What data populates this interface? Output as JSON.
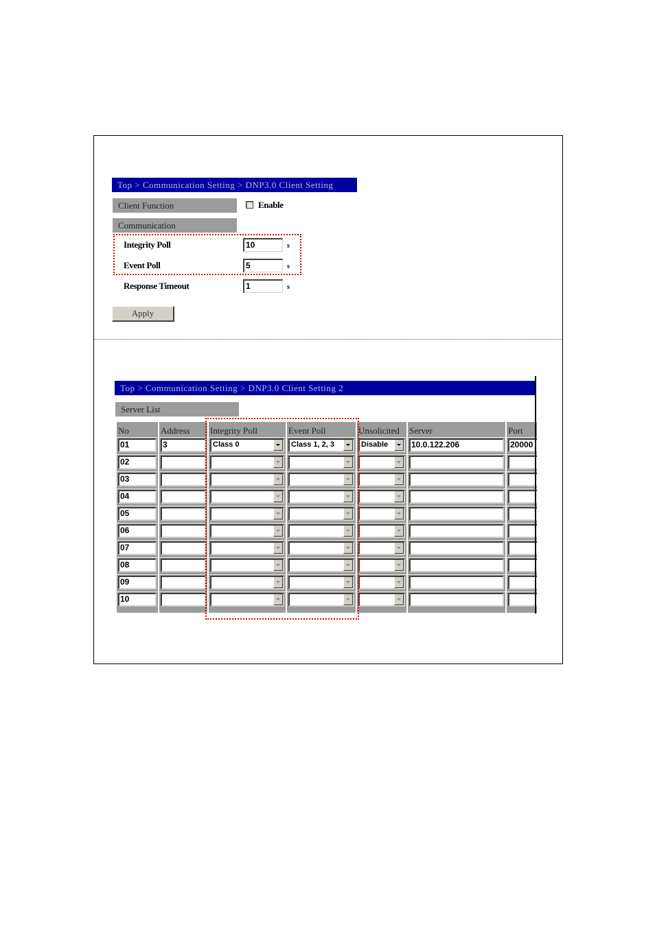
{
  "panel1": {
    "breadcrumb": "Top > Communication Setting > DNP3.0 Client Setting",
    "client_function_label": "Client Function",
    "enable_label": "Enable",
    "enable_checked": false,
    "communication_label": "Communication",
    "fields": [
      {
        "label": "Integrity Poll",
        "value": "10",
        "unit": "s"
      },
      {
        "label": "Event Poll",
        "value": "5",
        "unit": "s"
      },
      {
        "label": "Response Timeout",
        "value": "1",
        "unit": "s"
      }
    ],
    "apply_label": "Apply"
  },
  "panel2": {
    "breadcrumb": "Top > Communication Setting > DNP3.0 Client Setting 2",
    "server_list_label": "Server List",
    "columns": [
      "No",
      "Address",
      "Integrity Poll",
      "Event Poll",
      "Unsolicited",
      "Server",
      "Port"
    ],
    "rows": [
      {
        "no": "01",
        "address": "3",
        "integrity_poll": "Class 0",
        "event_poll": "Class 1, 2, 3",
        "unsolicited": "Disable",
        "server": "10.0.122.206",
        "port": "20000"
      },
      {
        "no": "02",
        "address": "",
        "integrity_poll": "",
        "event_poll": "",
        "unsolicited": "",
        "server": "",
        "port": ""
      },
      {
        "no": "03",
        "address": "",
        "integrity_poll": "",
        "event_poll": "",
        "unsolicited": "",
        "server": "",
        "port": ""
      },
      {
        "no": "04",
        "address": "",
        "integrity_poll": "",
        "event_poll": "",
        "unsolicited": "",
        "server": "",
        "port": ""
      },
      {
        "no": "05",
        "address": "",
        "integrity_poll": "",
        "event_poll": "",
        "unsolicited": "",
        "server": "",
        "port": ""
      },
      {
        "no": "06",
        "address": "",
        "integrity_poll": "",
        "event_poll": "",
        "unsolicited": "",
        "server": "",
        "port": ""
      },
      {
        "no": "07",
        "address": "",
        "integrity_poll": "",
        "event_poll": "",
        "unsolicited": "",
        "server": "",
        "port": ""
      },
      {
        "no": "08",
        "address": "",
        "integrity_poll": "",
        "event_poll": "",
        "unsolicited": "",
        "server": "",
        "port": ""
      },
      {
        "no": "09",
        "address": "",
        "integrity_poll": "",
        "event_poll": "",
        "unsolicited": "",
        "server": "",
        "port": ""
      },
      {
        "no": "10",
        "address": "",
        "integrity_poll": "",
        "event_poll": "",
        "unsolicited": "",
        "server": "",
        "port": ""
      }
    ]
  },
  "colors": {
    "title_bar": "#0000a0",
    "section_label": "#9c9c9c",
    "highlight": "#e00000"
  }
}
